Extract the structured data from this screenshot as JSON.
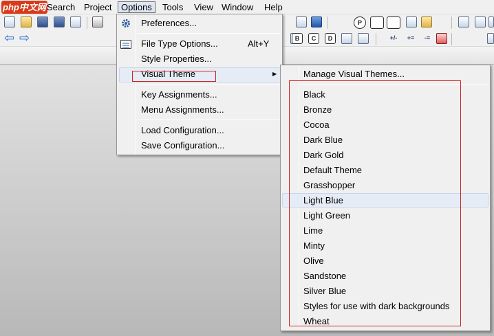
{
  "menubar": {
    "logo": "php中文网",
    "items": [
      "Search",
      "Project",
      "Options",
      "Tools",
      "View",
      "Window",
      "Help"
    ],
    "active": "Options"
  },
  "options_menu": {
    "preferences": "Preferences...",
    "file_type_options": "File Type Options...",
    "file_type_options_shortcut": "Alt+Y",
    "style_properties": "Style Properties...",
    "visual_theme": "Visual Theme",
    "submenu_arrow": "▶",
    "key_assignments": "Key Assignments...",
    "menu_assignments": "Menu Assignments...",
    "load_configuration": "Load Configuration...",
    "save_configuration": "Save Configuration..."
  },
  "visual_theme_menu": {
    "manage": "Manage Visual Themes...",
    "themes": [
      "Black",
      "Bronze",
      "Cocoa",
      "Dark Blue",
      "Dark Gold",
      "Default Theme",
      "Grasshopper",
      "Light Blue",
      "Light Green",
      "Lime",
      "Minty",
      "Olive",
      "Sandstone",
      "Silver Blue",
      "Styles for use with dark backgrounds",
      "Wheat"
    ],
    "highlighted": "Light Blue"
  },
  "toolbar": {
    "letter_buttons": [
      "B",
      "C",
      "D"
    ],
    "tool_labels": [
      "+/-",
      "+≡",
      "-≡"
    ],
    "back_arrow": "⇦",
    "forward_arrow": "⇨",
    "p_label": "P"
  },
  "colors": {
    "accent": "#d42020",
    "highlight": "#e5ecf6",
    "menu_bg": "#f0f0f0"
  }
}
